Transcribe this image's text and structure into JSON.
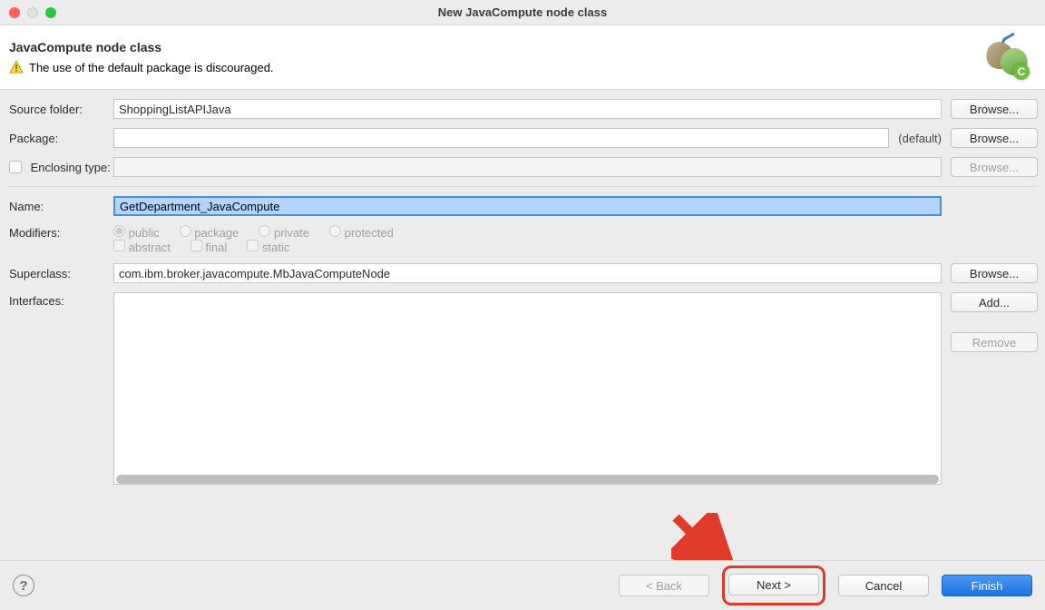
{
  "window": {
    "title": "New JavaCompute node class"
  },
  "header": {
    "heading": "JavaCompute node class",
    "warning": "The use of the default package is discouraged."
  },
  "labels": {
    "sourceFolder": "Source folder:",
    "package": "Package:",
    "enclosingType": "Enclosing type:",
    "name": "Name:",
    "modifiers": "Modifiers:",
    "superclass": "Superclass:",
    "interfaces": "Interfaces:",
    "defaultHint": "(default)"
  },
  "values": {
    "sourceFolder": "ShoppingListAPIJava",
    "package": "",
    "enclosingType": "",
    "name": "GetDepartment_JavaCompute",
    "superclass": "com.ibm.broker.javacompute.MbJavaComputeNode"
  },
  "modifiers": {
    "public": "public",
    "packagePriv": "package",
    "private": "private",
    "protected": "protected",
    "abstract": "abstract",
    "final": "final",
    "static": "static"
  },
  "buttons": {
    "browse": "Browse...",
    "add": "Add...",
    "remove": "Remove",
    "back": "< Back",
    "next": "Next >",
    "cancel": "Cancel",
    "finish": "Finish"
  }
}
